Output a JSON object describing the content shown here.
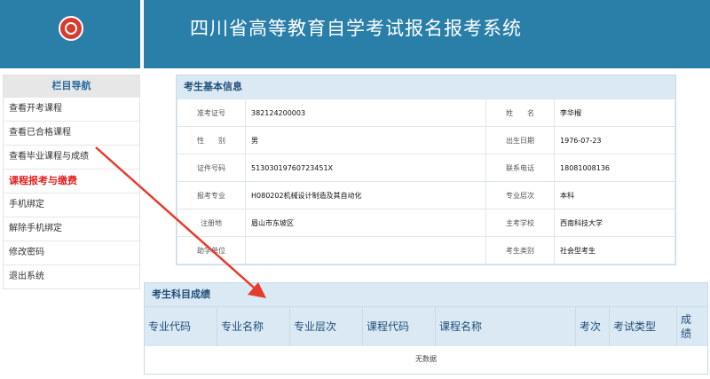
{
  "header": {
    "title": "四川省高等教育自学考试报名报考系统",
    "logo_icon": "university-seal-icon"
  },
  "sidebar": {
    "title": "栏目导航",
    "items": [
      {
        "label": "查看开考课程",
        "active": false
      },
      {
        "label": "查看已合格课程",
        "active": false
      },
      {
        "label": "查看毕业课程与成绩",
        "active": false
      },
      {
        "label": "课程报考与缴费",
        "active": true
      },
      {
        "label": "手机绑定",
        "active": false
      },
      {
        "label": "解除手机绑定",
        "active": false
      },
      {
        "label": "修改密码",
        "active": false
      },
      {
        "label": "退出系统",
        "active": false
      }
    ]
  },
  "info": {
    "title": "考生基本信息",
    "rows": [
      {
        "l1": "准考证号",
        "v1": "382124200003",
        "l2": "姓　　名",
        "v2": "李华榴"
      },
      {
        "l1": "性　　别",
        "v1": "男",
        "l2": "出生日期",
        "v2": "1976-07-23"
      },
      {
        "l1": "证件号码",
        "v1": "51303019760723451X",
        "l2": "联系电话",
        "v2": "18081008136"
      },
      {
        "l1": "报考专业",
        "v1": "H080202机械设计制造及其自动化",
        "l2": "专业层次",
        "v2": "本科"
      },
      {
        "l1": "注册地",
        "v1": "眉山市东坡区",
        "l2": "主考学校",
        "v2": "西南科技大学"
      },
      {
        "l1": "助学单位",
        "v1": "",
        "l2": "考生类别",
        "v2": "社会型考生"
      }
    ]
  },
  "scores": {
    "title": "考生科目成绩",
    "columns": [
      "专业代码",
      "专业名称",
      "专业层次",
      "课程代码",
      "课程名称",
      "考次",
      "考试类型",
      "成绩"
    ],
    "empty_text": "无数据"
  },
  "annotation": {
    "color": "#e53b2c"
  }
}
